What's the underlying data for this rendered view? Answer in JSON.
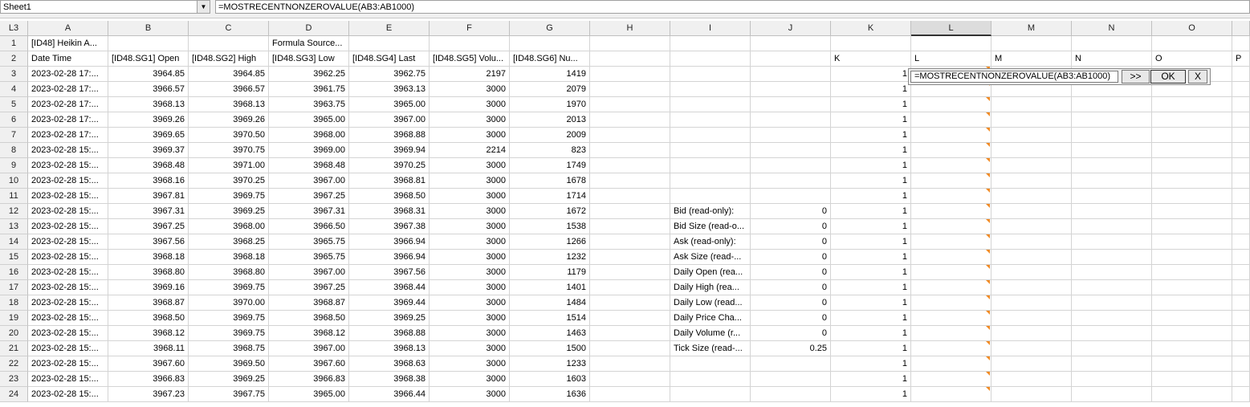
{
  "top": {
    "sheet_name": "Sheet1",
    "formula": "=MOSTRECENTNONZEROVALUE(AB3:AB1000)",
    "cell_ref": "L3"
  },
  "columns": [
    "A",
    "B",
    "C",
    "D",
    "E",
    "F",
    "G",
    "H",
    "I",
    "J",
    "K",
    "L",
    "M",
    "N",
    "O"
  ],
  "row1": {
    "A": "[ID48] Heikin A...",
    "D": "Formula Source..."
  },
  "row2": {
    "A": "Date Time",
    "B": "[ID48.SG1] Open",
    "C": "[ID48.SG2] High",
    "D": "[ID48.SG3] Low",
    "E": "[ID48.SG4] Last",
    "F": "[ID48.SG5] Volu...",
    "G": "[ID48.SG6] Nu...",
    "K": "K",
    "L": "L",
    "M": "M",
    "N": "N",
    "O": "O",
    "P": "P"
  },
  "rows": [
    {
      "n": "3",
      "A": "2023-02-28  17:...",
      "B": "3964.85",
      "C": "3964.85",
      "D": "3962.25",
      "E": "3962.75",
      "F": "2197",
      "G": "1419",
      "K": "1"
    },
    {
      "n": "4",
      "A": "2023-02-28  17:...",
      "B": "3966.57",
      "C": "3966.57",
      "D": "3961.75",
      "E": "3963.13",
      "F": "3000",
      "G": "2079",
      "K": "1"
    },
    {
      "n": "5",
      "A": "2023-02-28  17:...",
      "B": "3968.13",
      "C": "3968.13",
      "D": "3963.75",
      "E": "3965.00",
      "F": "3000",
      "G": "1970",
      "K": "1"
    },
    {
      "n": "6",
      "A": "2023-02-28  17:...",
      "B": "3969.26",
      "C": "3969.26",
      "D": "3965.00",
      "E": "3967.00",
      "F": "3000",
      "G": "2013",
      "K": "1"
    },
    {
      "n": "7",
      "A": "2023-02-28  17:...",
      "B": "3969.65",
      "C": "3970.50",
      "D": "3968.00",
      "E": "3968.88",
      "F": "3000",
      "G": "2009",
      "K": "1"
    },
    {
      "n": "8",
      "A": "2023-02-28  15:...",
      "B": "3969.37",
      "C": "3970.75",
      "D": "3969.00",
      "E": "3969.94",
      "F": "2214",
      "G": "823",
      "K": "1"
    },
    {
      "n": "9",
      "A": "2023-02-28  15:...",
      "B": "3968.48",
      "C": "3971.00",
      "D": "3968.48",
      "E": "3970.25",
      "F": "3000",
      "G": "1749",
      "K": "1"
    },
    {
      "n": "10",
      "A": "2023-02-28  15:...",
      "B": "3968.16",
      "C": "3970.25",
      "D": "3967.00",
      "E": "3968.81",
      "F": "3000",
      "G": "1678",
      "K": "1"
    },
    {
      "n": "11",
      "A": "2023-02-28  15:...",
      "B": "3967.81",
      "C": "3969.75",
      "D": "3967.25",
      "E": "3968.50",
      "F": "3000",
      "G": "1714",
      "K": "1"
    },
    {
      "n": "12",
      "A": "2023-02-28  15:...",
      "B": "3967.31",
      "C": "3969.25",
      "D": "3967.31",
      "E": "3968.31",
      "F": "3000",
      "G": "1672",
      "I": "Bid (read-only):",
      "J": "0",
      "K": "1"
    },
    {
      "n": "13",
      "A": "2023-02-28  15:...",
      "B": "3967.25",
      "C": "3968.00",
      "D": "3966.50",
      "E": "3967.38",
      "F": "3000",
      "G": "1538",
      "I": "Bid Size (read-o...",
      "J": "0",
      "K": "1"
    },
    {
      "n": "14",
      "A": "2023-02-28  15:...",
      "B": "3967.56",
      "C": "3968.25",
      "D": "3965.75",
      "E": "3966.94",
      "F": "3000",
      "G": "1266",
      "I": "Ask (read-only):",
      "J": "0",
      "K": "1"
    },
    {
      "n": "15",
      "A": "2023-02-28  15:...",
      "B": "3968.18",
      "C": "3968.18",
      "D": "3965.75",
      "E": "3966.94",
      "F": "3000",
      "G": "1232",
      "I": "Ask Size (read-...",
      "J": "0",
      "K": "1"
    },
    {
      "n": "16",
      "A": "2023-02-28  15:...",
      "B": "3968.80",
      "C": "3968.80",
      "D": "3967.00",
      "E": "3967.56",
      "F": "3000",
      "G": "1179",
      "I": "Daily Open (rea...",
      "J": "0",
      "K": "1"
    },
    {
      "n": "17",
      "A": "2023-02-28  15:...",
      "B": "3969.16",
      "C": "3969.75",
      "D": "3967.25",
      "E": "3968.44",
      "F": "3000",
      "G": "1401",
      "I": "Daily High (rea...",
      "J": "0",
      "K": "1"
    },
    {
      "n": "18",
      "A": "2023-02-28  15:...",
      "B": "3968.87",
      "C": "3970.00",
      "D": "3968.87",
      "E": "3969.44",
      "F": "3000",
      "G": "1484",
      "I": "Daily Low (read...",
      "J": "0",
      "K": "1"
    },
    {
      "n": "19",
      "A": "2023-02-28  15:...",
      "B": "3968.50",
      "C": "3969.75",
      "D": "3968.50",
      "E": "3969.25",
      "F": "3000",
      "G": "1514",
      "I": "Daily Price Cha...",
      "J": "0",
      "K": "1"
    },
    {
      "n": "20",
      "A": "2023-02-28  15:...",
      "B": "3968.12",
      "C": "3969.75",
      "D": "3968.12",
      "E": "3968.88",
      "F": "3000",
      "G": "1463",
      "I": "Daily Volume (r...",
      "J": "0",
      "K": "1"
    },
    {
      "n": "21",
      "A": "2023-02-28  15:...",
      "B": "3968.11",
      "C": "3968.75",
      "D": "3967.00",
      "E": "3968.13",
      "F": "3000",
      "G": "1500",
      "I": "Tick Size (read-...",
      "J": "0.25",
      "K": "1"
    },
    {
      "n": "22",
      "A": "2023-02-28  15:...",
      "B": "3967.60",
      "C": "3969.50",
      "D": "3967.60",
      "E": "3968.63",
      "F": "3000",
      "G": "1233",
      "K": "1"
    },
    {
      "n": "23",
      "A": "2023-02-28  15:...",
      "B": "3966.83",
      "C": "3969.25",
      "D": "3966.83",
      "E": "3968.38",
      "F": "3000",
      "G": "1603",
      "K": "1"
    },
    {
      "n": "24",
      "A": "2023-02-28  15:...",
      "B": "3967.23",
      "C": "3967.75",
      "D": "3965.00",
      "E": "3966.44",
      "F": "3000",
      "G": "1636",
      "K": "1"
    }
  ],
  "editor": {
    "formula": "=MOSTRECENTNONZEROVALUE(AB3:AB1000)",
    "expand_label": ">>",
    "ok_label": "OK",
    "cancel_label": "X"
  }
}
